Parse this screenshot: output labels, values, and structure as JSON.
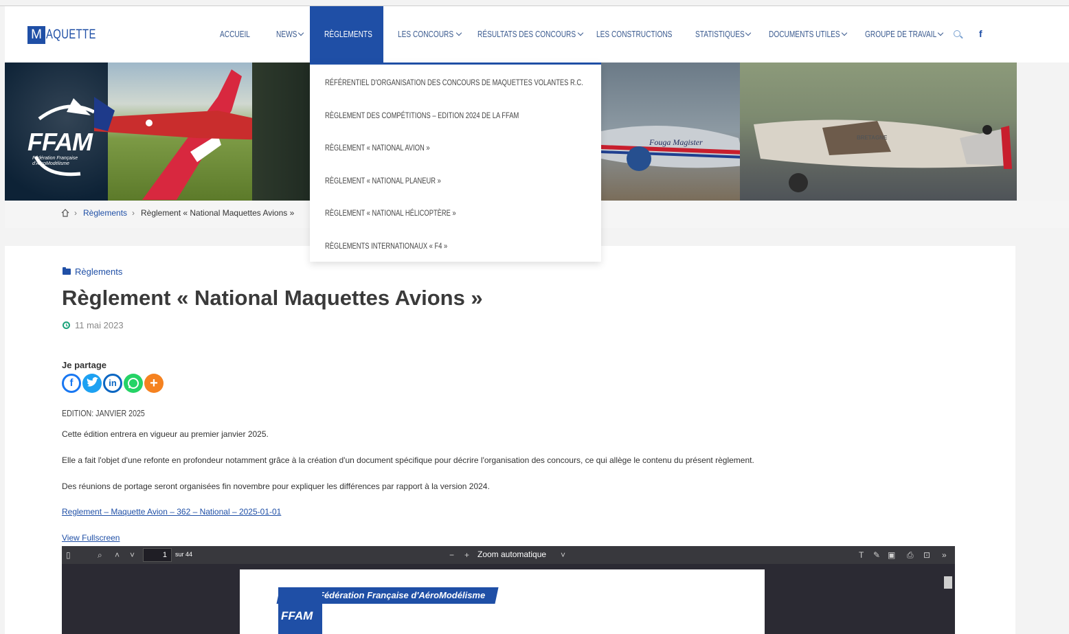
{
  "brand": {
    "initial": "M",
    "rest": "AQUETTE"
  },
  "nav": {
    "items": [
      {
        "label": "Accueil",
        "dropdown": false
      },
      {
        "label": "News",
        "dropdown": true
      },
      {
        "label": "Règlements",
        "dropdown": false,
        "active": true
      },
      {
        "label": "Les concours",
        "dropdown": true
      },
      {
        "label": "Résultats des concours",
        "dropdown": true
      },
      {
        "label": "Les constructions",
        "dropdown": false
      },
      {
        "label": "Statistiques",
        "dropdown": true
      },
      {
        "label": "Documents utiles",
        "dropdown": true
      },
      {
        "label": "Groupe de travail",
        "dropdown": true
      }
    ],
    "search_icon": "search-icon",
    "facebook_icon": "f"
  },
  "banner": {
    "logo_text": "FFAM",
    "logo_sub": "Fédération Française d'AéroModélisme",
    "plane_label_1": "Fouga Magister",
    "plane_label_2": "BRETAGNE"
  },
  "dropdown": {
    "items": [
      "Référentiel d'organisation des concours de maquettes volantes R.C.",
      "Règlement des compétitions – Edition 2024 de la FFAM",
      "Règlement « National Avion »",
      "Règlement « National Planeur »",
      "Règlement « National Hélicoptère »",
      "Règlements internationaux « F4 »"
    ]
  },
  "breadcrumb": {
    "link": "Règlements",
    "current": "Règlement « National Maquettes Avions »"
  },
  "article": {
    "category": "Règlements",
    "title": "Règlement « National Maquettes Avions »",
    "date": "11 mai 2023",
    "share_label": "Je partage",
    "edition": "EDITION: JANVIER 2025",
    "paragraphs": [
      "Cette édition entrera en vigueur au premier janvier 2025.",
      "Elle a fait l'objet d'une refonte en profondeur notamment grâce à la création d'un document spécifique pour décrire l'organisation des concours, ce qui allège le contenu du présent règlement.",
      "Des réunions de portage seront organisées fin novembre pour expliquer les différences par rapport à la version 2024."
    ],
    "doc_link": "Reglement – Maquette Avion – 362 – National – 2025-01-01",
    "fullscreen_link": "View Fullscreen"
  },
  "viewer": {
    "page": "1",
    "page_total": "sur 44",
    "zoom": "Zoom automatique",
    "doc_header": "Fédération Française d'AéroModélisme",
    "doc_logo": "FFAM"
  },
  "colors": {
    "accent": "#1f4fa6",
    "facebook": "#1877f2",
    "twitter": "#1da1f2",
    "linkedin": "#0a66c2",
    "whatsapp": "#25d366",
    "more": "#f58220"
  }
}
